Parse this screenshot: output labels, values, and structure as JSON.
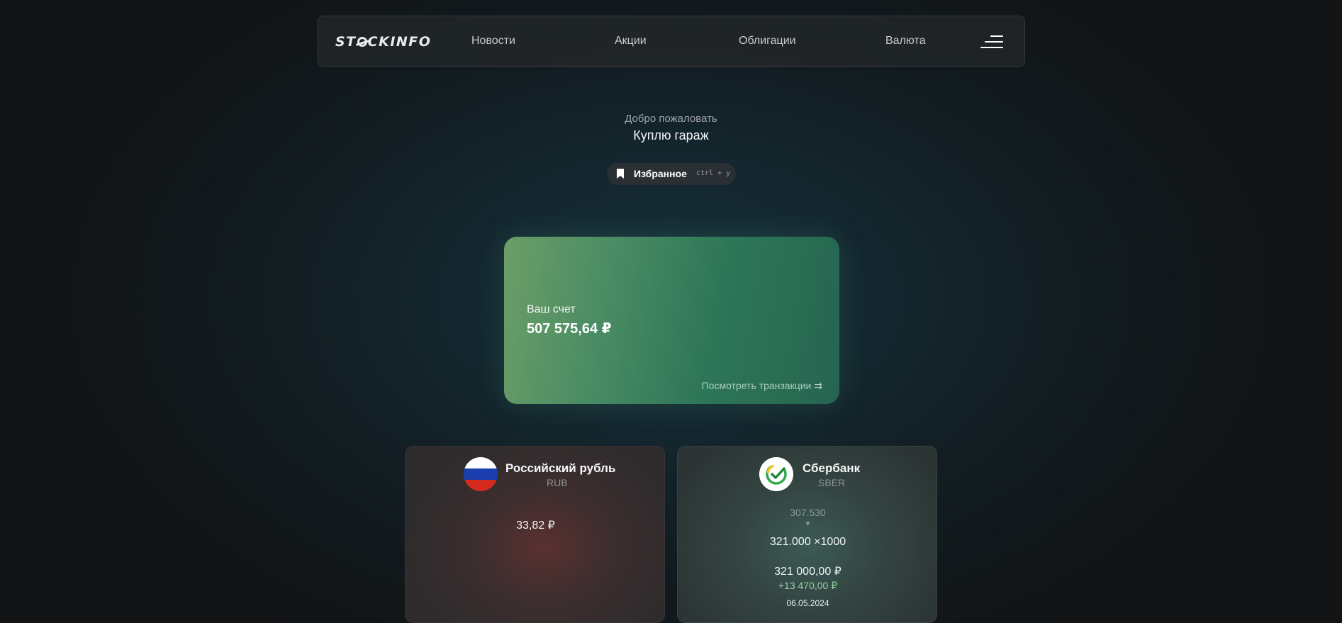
{
  "nav": {
    "logo": "STOCKINFO",
    "links": [
      "Новости",
      "Акции",
      "Облигации",
      "Валюта"
    ]
  },
  "welcome": {
    "subtitle": "Добро пожаловать",
    "name": "Куплю гараж"
  },
  "favorites": {
    "label": "Избранное",
    "shortcut": "ctrl + y"
  },
  "account": {
    "label": "Ваш счет",
    "balance": "507 575,64 ₽",
    "transactions_link": "Посмотреть транзакции ⇉",
    "accent_color": "#2e7658"
  },
  "assets": [
    {
      "name": "Российский рубль",
      "code": "RUB",
      "price": "33,82 ₽",
      "icon": "russia-flag-icon",
      "glow_color": "#5a302f"
    },
    {
      "name": "Сбербанк",
      "code": "SBER",
      "previous": "307.530",
      "direction_icon": "triangle-down-icon",
      "quantity": "321.000 ×1000",
      "total": "321 000,00 ₽",
      "change": "+13 470,00 ₽",
      "date": "06.05.2024",
      "icon": "sber-logo-icon",
      "glow_color": "#3c5a55"
    }
  ]
}
